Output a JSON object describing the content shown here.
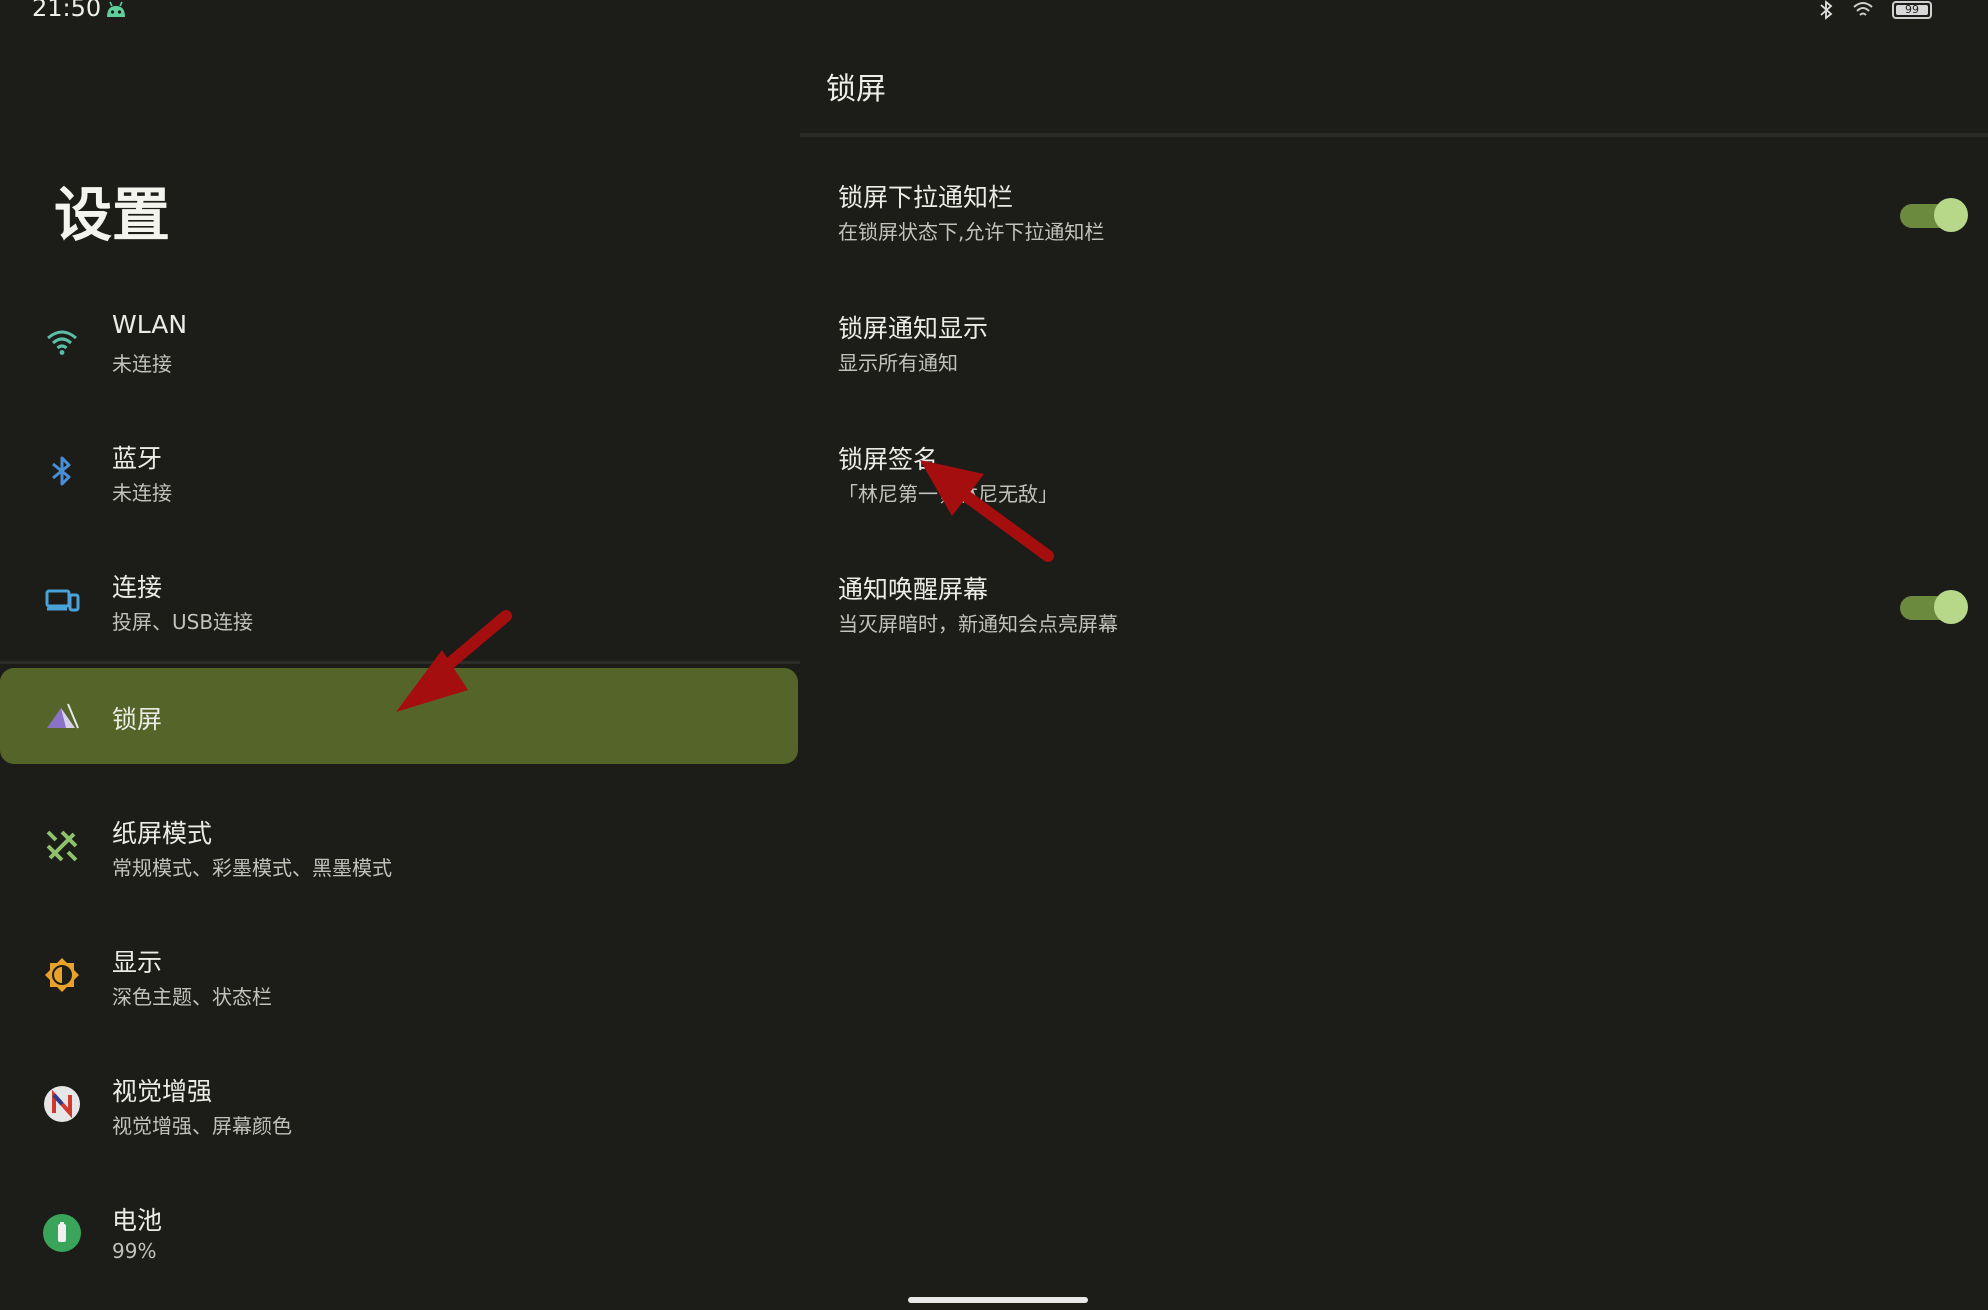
{
  "status_bar": {
    "time": "21:50",
    "battery": "99"
  },
  "left": {
    "title": "设置",
    "items": [
      {
        "label": "WLAN",
        "sub": "未连接",
        "icon": "wifi-icon"
      },
      {
        "label": "蓝牙",
        "sub": "未连接",
        "icon": "bluetooth-icon"
      },
      {
        "label": "连接",
        "sub": "投屏、USB连接",
        "icon": "devices-icon"
      },
      {
        "label": "锁屏",
        "sub": "",
        "icon": "lockscreen-icon"
      },
      {
        "label": "纸屏模式",
        "sub": "常规模式、彩墨模式、黑墨模式",
        "icon": "paper-mode-icon"
      },
      {
        "label": "显示",
        "sub": "深色主题、状态栏",
        "icon": "brightness-icon"
      },
      {
        "label": "视觉增强",
        "sub": "视觉增强、屏幕颜色",
        "icon": "vision-icon"
      },
      {
        "label": "电池",
        "sub": "99%",
        "icon": "battery-icon"
      }
    ]
  },
  "right": {
    "title": "锁屏",
    "settings": [
      {
        "label": "锁屏下拉通知栏",
        "sub": "在锁屏状态下,允许下拉通知栏",
        "toggle": true
      },
      {
        "label": "锁屏通知显示",
        "sub": "显示所有通知",
        "toggle": null
      },
      {
        "label": "锁屏签名",
        "sub": "「林尼第一，林尼无敌」",
        "toggle": null
      },
      {
        "label": "通知唤醒屏幕",
        "sub": "当灭屏暗时，新通知会点亮屏幕",
        "toggle": true
      }
    ]
  },
  "colors": {
    "background": "#1c1c19",
    "active_item": "#556428",
    "switch_track": "#6b8a3e",
    "switch_thumb": "#b8d889",
    "annotation_arrow": "#a50e0e"
  }
}
